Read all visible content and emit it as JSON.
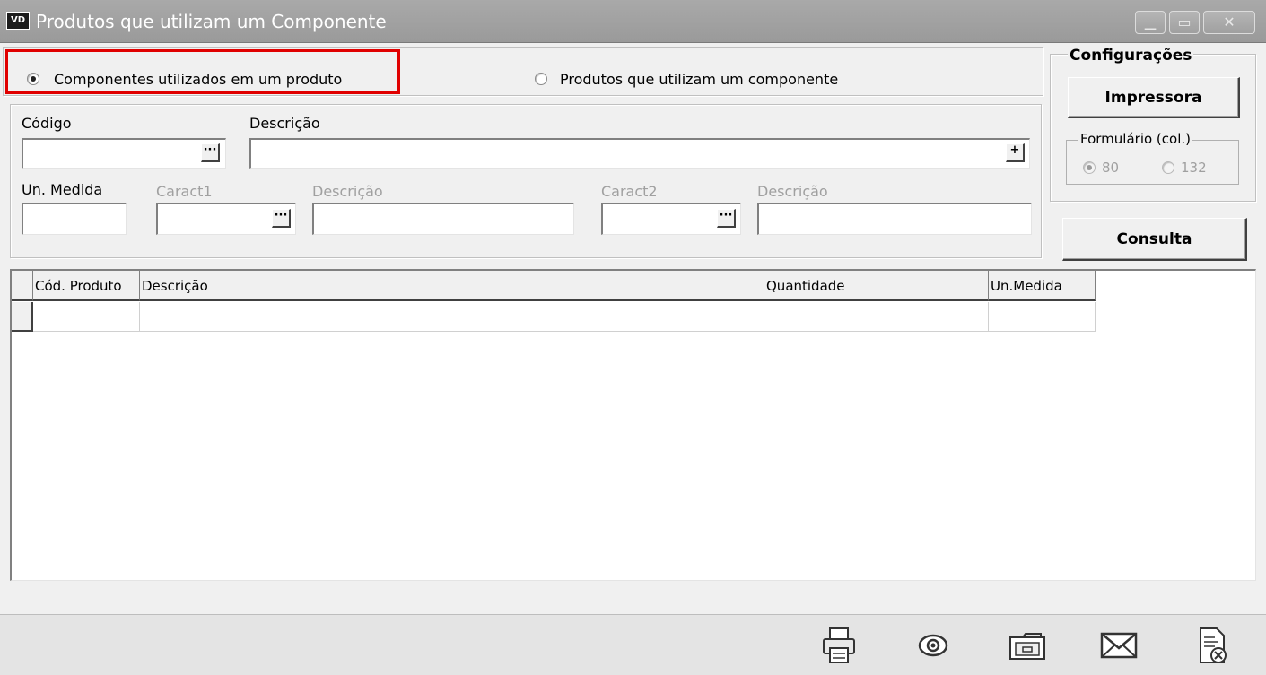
{
  "window": {
    "app_icon_text": "VD",
    "title": "Produtos que utilizam um Componente"
  },
  "mode": {
    "option1_label": "Componentes utilizados em um produto",
    "option2_label": "Produtos que utilizam um componente",
    "selected": "option1"
  },
  "fields": {
    "codigo_label": "Código",
    "descricao_label": "Descrição",
    "un_medida_label": "Un. Medida",
    "caract1_label": "Caract1",
    "caract1_descricao_label": "Descrição",
    "caract2_label": "Caract2",
    "caract2_descricao_label": "Descrição",
    "lookup_glyph": "···",
    "add_glyph": "+",
    "codigo_value": "",
    "descricao_value": "",
    "un_medida_value": "",
    "caract1_value": "",
    "caract1_descricao_value": "",
    "caract2_value": "",
    "caract2_descricao_value": ""
  },
  "config": {
    "title": "Configurações",
    "printer_button": "Impressora",
    "form_group_label": "Formulário (col.)",
    "col80_label": "80",
    "col132_label": "132",
    "selected_columns": "80",
    "query_button": "Consulta"
  },
  "grid": {
    "columns": [
      "Cód. Produto",
      "Descrição",
      "Quantidade",
      "Un.Medida"
    ],
    "rows": [
      [
        "",
        "",
        "",
        ""
      ]
    ]
  },
  "toolbar": {
    "icons": [
      "printer-icon",
      "preview-eye-icon",
      "folder-icon",
      "email-icon",
      "close-document-icon"
    ]
  },
  "colors": {
    "titlebar": "#a3a3a3",
    "highlight": "#e00000",
    "window_bg": "#f0f0f0"
  }
}
